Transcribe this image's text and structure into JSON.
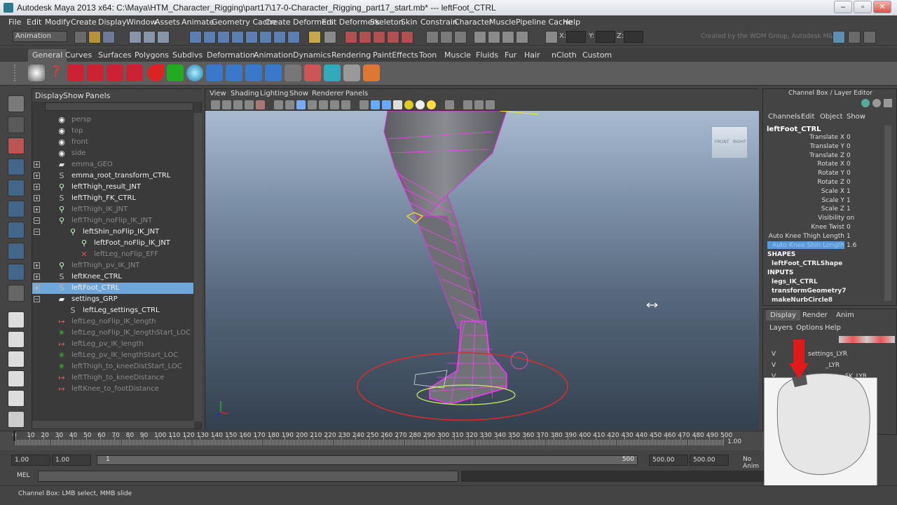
{
  "window": {
    "title": "Autodesk Maya 2013 x64: C:\\Maya\\HTM_Character_Rigging\\part17\\17-0-Character_Rigging_part17_start.mb*  ---  leftFoot_CTRL",
    "minimize": "–",
    "maximize": "▫",
    "close": "✕"
  },
  "menubar": [
    "File",
    "Edit",
    "Modify",
    "Create",
    "Display",
    "Window",
    "Assets",
    "Animate",
    "Geometry Cache",
    "Create Deformers",
    "Edit Deformers",
    "Skeleton",
    "Skin",
    "Constrain",
    "Character",
    "Muscle",
    "Pipeline Cache",
    "Help"
  ],
  "statusline": {
    "mode": "Animation",
    "x_label": "X:",
    "y_label": "Y:",
    "z_label": "Z:",
    "credit": "Created by the WDM Group, Autodesk M&E"
  },
  "shelf_tabs": [
    "General",
    "Curves",
    "Surfaces",
    "Polygons",
    "Subdivs",
    "Deformation",
    "Animation",
    "Dynamics",
    "Rendering",
    "PaintEffects",
    "Toon",
    "Muscle",
    "Fluids",
    "Fur",
    "Hair",
    "nCloth",
    "Custom"
  ],
  "outliner": {
    "menu": [
      "Display",
      "Show",
      "Panels"
    ],
    "rows": [
      {
        "label": "persp",
        "depth": 0,
        "exp": "",
        "icon": "camera-icon",
        "glyph": "◉",
        "dim": true
      },
      {
        "label": "top",
        "depth": 0,
        "exp": "",
        "icon": "camera-icon",
        "glyph": "◉",
        "dim": true
      },
      {
        "label": "front",
        "depth": 0,
        "exp": "",
        "icon": "camera-icon",
        "glyph": "◉",
        "dim": true
      },
      {
        "label": "side",
        "depth": 0,
        "exp": "",
        "icon": "camera-icon",
        "glyph": "◉",
        "dim": true
      },
      {
        "label": "emma_GEO",
        "depth": 0,
        "exp": "+",
        "icon": "mesh-icon",
        "glyph": "▰",
        "dim": true
      },
      {
        "label": "emma_root_transform_CTRL",
        "depth": 0,
        "exp": "+",
        "icon": "curve-icon",
        "glyph": "S",
        "dim": false
      },
      {
        "label": "leftThigh_result_JNT",
        "depth": 0,
        "exp": "+",
        "icon": "joint-icon",
        "glyph": "⚲",
        "dim": false
      },
      {
        "label": "leftThigh_FK_CTRL",
        "depth": 0,
        "exp": "+",
        "icon": "curve-icon",
        "glyph": "S",
        "dim": false
      },
      {
        "label": "leftThigh_IK_JNT",
        "depth": 0,
        "exp": "+",
        "icon": "joint-icon",
        "glyph": "⚲",
        "dim": true
      },
      {
        "label": "leftThigh_noFlip_IK_JNT",
        "depth": 0,
        "exp": "−",
        "icon": "joint-icon",
        "glyph": "⚲",
        "dim": true
      },
      {
        "label": "leftShin_noFlip_IK_JNT",
        "depth": 1,
        "exp": "−",
        "icon": "joint-icon",
        "glyph": "⚲",
        "dim": false
      },
      {
        "label": "leftFoot_noFlip_IK_JNT",
        "depth": 2,
        "exp": "",
        "icon": "joint-icon",
        "glyph": "⚲",
        "dim": false
      },
      {
        "label": "leftLeg_noFlip_EFF",
        "depth": 2,
        "exp": "",
        "icon": "effector-icon",
        "glyph": "✕",
        "dim": true
      },
      {
        "label": "leftThigh_pv_IK_JNT",
        "depth": 0,
        "exp": "+",
        "icon": "joint-icon",
        "glyph": "⚲",
        "dim": true
      },
      {
        "label": "leftKnee_CTRL",
        "depth": 0,
        "exp": "+",
        "icon": "curve-icon",
        "glyph": "S",
        "dim": false
      },
      {
        "label": "leftFoot_CTRL",
        "depth": 0,
        "exp": "+",
        "icon": "curve-icon",
        "glyph": "S",
        "dim": false,
        "selected": true
      },
      {
        "label": "settings_GRP",
        "depth": 0,
        "exp": "−",
        "icon": "group-icon",
        "glyph": "▰",
        "dim": false
      },
      {
        "label": "leftLeg_settings_CTRL",
        "depth": 1,
        "exp": "",
        "icon": "curve-icon",
        "glyph": "S",
        "dim": false
      },
      {
        "label": "leftLeg_noFlip_IK_length",
        "depth": 0,
        "exp": "",
        "icon": "distance-icon",
        "glyph": "↦",
        "dim": true
      },
      {
        "label": "leftLeg_noFlip_IK_lengthStart_LOC",
        "depth": 0,
        "exp": "",
        "icon": "locator-icon",
        "glyph": "✳",
        "dim": true
      },
      {
        "label": "leftLeg_pv_IK_length",
        "depth": 0,
        "exp": "",
        "icon": "distance-icon",
        "glyph": "↦",
        "dim": true
      },
      {
        "label": "leftLeg_pv_IK_lengthStart_LOC",
        "depth": 0,
        "exp": "",
        "icon": "locator-icon",
        "glyph": "✳",
        "dim": true
      },
      {
        "label": "leftThigh_to_kneeDistStart_LOC",
        "depth": 0,
        "exp": "",
        "icon": "locator-icon",
        "glyph": "✳",
        "dim": true
      },
      {
        "label": "leftThigh_to_kneeDistance",
        "depth": 0,
        "exp": "",
        "icon": "distance-icon",
        "glyph": "↦",
        "dim": true
      },
      {
        "label": "leftKnee_to_footDistance",
        "depth": 0,
        "exp": "",
        "icon": "distance-icon",
        "glyph": "↦",
        "dim": true
      }
    ]
  },
  "viewport": {
    "menu": [
      "View",
      "Shading",
      "Lighting",
      "Show",
      "Renderer",
      "Panels"
    ],
    "viewcube_front": "FRONT",
    "viewcube_right": "RIGHT"
  },
  "channelbox": {
    "header": "Channel Box / Layer Editor",
    "menu": [
      "Channels",
      "Edit",
      "Object",
      "Show"
    ],
    "node": "leftFoot_CTRL",
    "attrs": [
      {
        "name": "Translate X",
        "value": "0"
      },
      {
        "name": "Translate Y",
        "value": "0"
      },
      {
        "name": "Translate Z",
        "value": "0"
      },
      {
        "name": "Rotate X",
        "value": "0"
      },
      {
        "name": "Rotate Y",
        "value": "0"
      },
      {
        "name": "Rotate Z",
        "value": "0"
      },
      {
        "name": "Scale X",
        "value": "1"
      },
      {
        "name": "Scale Y",
        "value": "1"
      },
      {
        "name": "Scale Z",
        "value": "1"
      },
      {
        "name": "Visibility",
        "value": "on"
      },
      {
        "name": "Knee Twist",
        "value": "0"
      },
      {
        "name": "Auto Knee Thigh Length",
        "value": "1"
      },
      {
        "name": "Auto Knee Shin Length",
        "value": "1.6",
        "selected": true
      }
    ],
    "shapes_label": "SHAPES",
    "shape": "leftFoot_CTRLShape",
    "inputs_label": "INPUTS",
    "inputs": [
      "legs_IK_CTRL",
      "transformGeometry7",
      "makeNurbCircle8"
    ]
  },
  "layers": {
    "tabs": [
      "Display",
      "Render",
      "Anim"
    ],
    "menu": [
      "Layers",
      "Options",
      "Help"
    ],
    "rows": [
      {
        "v": "V",
        "name": "settings_LYR"
      },
      {
        "v": "V",
        "name": "_LYR"
      },
      {
        "v": "V",
        "name": "FK_LYR"
      }
    ]
  },
  "timeline": {
    "ticks": [
      "0",
      "10",
      "20",
      "30",
      "40",
      "50",
      "60",
      "70",
      "80",
      "90",
      "100",
      "110",
      "120",
      "130",
      "140",
      "150",
      "160",
      "170",
      "180",
      "190",
      "200",
      "210",
      "220",
      "230",
      "240",
      "250",
      "260",
      "270",
      "280",
      "290",
      "300",
      "310",
      "320",
      "330",
      "340",
      "350",
      "360",
      "370",
      "380",
      "390",
      "400",
      "410",
      "420",
      "430",
      "440",
      "450",
      "460",
      "470",
      "480",
      "490",
      "500"
    ],
    "current": "1.00"
  },
  "range": {
    "start": "1.00",
    "playback_start": "1.00",
    "slider_start": "1",
    "slider_end": "500",
    "playback_end": "500.00",
    "end": "500.00",
    "anim_layer": "No Anim"
  },
  "mel_label": "MEL",
  "helpline": "Channel Box: LMB select, MMB slide"
}
